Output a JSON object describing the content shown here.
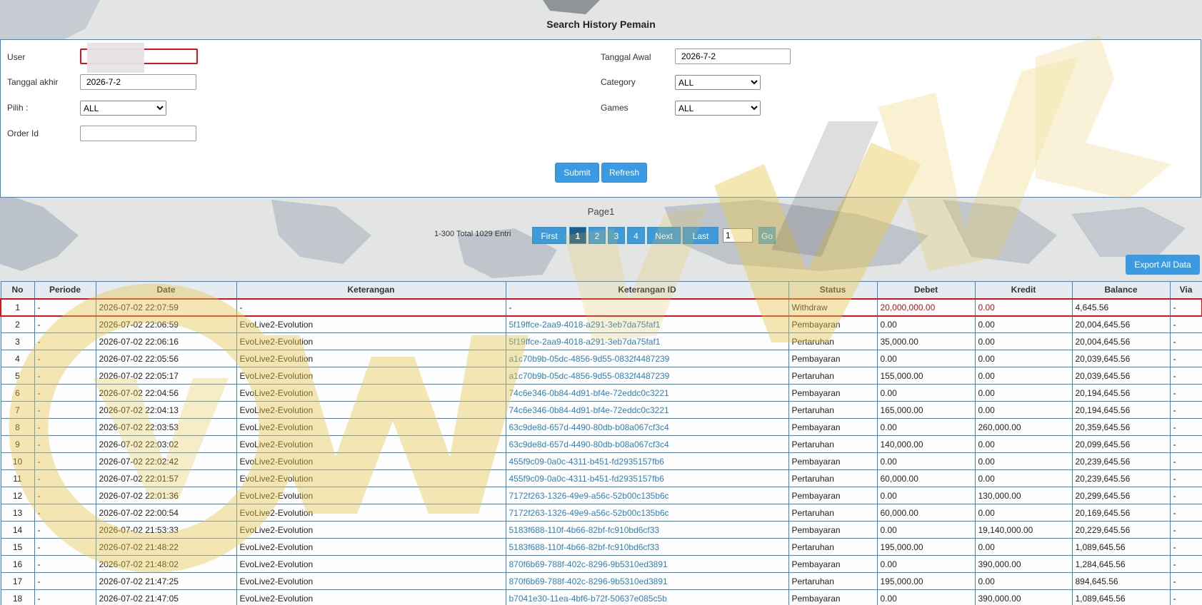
{
  "page_title": "Search History Pemain",
  "form": {
    "user_label": "User",
    "user_value": "",
    "tanggal_akhir_label": "Tanggal akhir",
    "tanggal_akhir_value": "2026-7-2",
    "pilih_label": "Pilih  :",
    "pilih_value": "ALL",
    "order_id_label": "Order Id",
    "order_id_value": "",
    "tanggal_awal_label": "Tanggal Awal",
    "tanggal_awal_value": "2026-7-2",
    "category_label": "Category",
    "category_value": "ALL",
    "games_label": "Games",
    "games_value": "ALL",
    "submit_label": "Submit",
    "refresh_label": "Refresh"
  },
  "pagination": {
    "page_label": "Page1",
    "info": "1-300 Total 1029 Entri",
    "first": "First",
    "pages": [
      "1",
      "2",
      "3",
      "4"
    ],
    "next": "Next",
    "last": "Last",
    "goto_value": "1",
    "go": "Go"
  },
  "export_label": "Export All Data",
  "table": {
    "headers": [
      "No",
      "Periode",
      "Date",
      "Keterangan",
      "Keterangan ID",
      "Status",
      "Debet",
      "Kredit",
      "Balance",
      "Via"
    ],
    "rows": [
      [
        "1",
        "-",
        "2026-07-02 22:07:59",
        "-",
        "-",
        "Withdraw",
        "20,000,000.00",
        "0.00",
        "4,645.56",
        "-"
      ],
      [
        "2",
        "-",
        "2026-07-02 22:06:59",
        "EvoLive2-Evolution",
        "5f19ffce-2aa9-4018-a291-3eb7da75faf1",
        "Pembayaran",
        "0.00",
        "0.00",
        "20,004,645.56",
        "-"
      ],
      [
        "3",
        "-",
        "2026-07-02 22:06:16",
        "EvoLive2-Evolution",
        "5f19ffce-2aa9-4018-a291-3eb7da75faf1",
        "Pertaruhan",
        "35,000.00",
        "0.00",
        "20,004,645.56",
        "-"
      ],
      [
        "4",
        "-",
        "2026-07-02 22:05:56",
        "EvoLive2-Evolution",
        "a1c70b9b-05dc-4856-9d55-0832f4487239",
        "Pembayaran",
        "0.00",
        "0.00",
        "20,039,645.56",
        "-"
      ],
      [
        "5",
        "-",
        "2026-07-02 22:05:17",
        "EvoLive2-Evolution",
        "a1c70b9b-05dc-4856-9d55-0832f4487239",
        "Pertaruhan",
        "155,000.00",
        "0.00",
        "20,039,645.56",
        "-"
      ],
      [
        "6",
        "-",
        "2026-07-02 22:04:56",
        "EvoLive2-Evolution",
        "74c6e346-0b84-4d91-bf4e-72eddc0c3221",
        "Pembayaran",
        "0.00",
        "0.00",
        "20,194,645.56",
        "-"
      ],
      [
        "7",
        "-",
        "2026-07-02 22:04:13",
        "EvoLive2-Evolution",
        "74c6e346-0b84-4d91-bf4e-72eddc0c3221",
        "Pertaruhan",
        "165,000.00",
        "0.00",
        "20,194,645.56",
        "-"
      ],
      [
        "8",
        "-",
        "2026-07-02 22:03:53",
        "EvoLive2-Evolution",
        "63c9de8d-657d-4490-80db-b08a067cf3c4",
        "Pembayaran",
        "0.00",
        "260,000.00",
        "20,359,645.56",
        "-"
      ],
      [
        "9",
        "-",
        "2026-07-02 22:03:02",
        "EvoLive2-Evolution",
        "63c9de8d-657d-4490-80db-b08a067cf3c4",
        "Pertaruhan",
        "140,000.00",
        "0.00",
        "20,099,645.56",
        "-"
      ],
      [
        "10",
        "-",
        "2026-07-02 22:02:42",
        "EvoLive2-Evolution",
        "455f9c09-0a0c-4311-b451-fd2935157fb6",
        "Pembayaran",
        "0.00",
        "0.00",
        "20,239,645.56",
        "-"
      ],
      [
        "11",
        "-",
        "2026-07-02 22:01:57",
        "EvoLive2-Evolution",
        "455f9c09-0a0c-4311-b451-fd2935157fb6",
        "Pertaruhan",
        "60,000.00",
        "0.00",
        "20,239,645.56",
        "-"
      ],
      [
        "12",
        "-",
        "2026-07-02 22:01:36",
        "EvoLive2-Evolution",
        "7172f263-1326-49e9-a56c-52b00c135b6c",
        "Pembayaran",
        "0.00",
        "130,000.00",
        "20,299,645.56",
        "-"
      ],
      [
        "13",
        "-",
        "2026-07-02 22:00:54",
        "EvoLive2-Evolution",
        "7172f263-1326-49e9-a56c-52b00c135b6c",
        "Pertaruhan",
        "60,000.00",
        "0.00",
        "20,169,645.56",
        "-"
      ],
      [
        "14",
        "-",
        "2026-07-02 21:53:33",
        "EvoLive2-Evolution",
        "5183f688-110f-4b66-82bf-fc910bd6cf33",
        "Pembayaran",
        "0.00",
        "19,140,000.00",
        "20,229,645.56",
        "-"
      ],
      [
        "15",
        "-",
        "2026-07-02 21:48:22",
        "EvoLive2-Evolution",
        "5183f688-110f-4b66-82bf-fc910bd6cf33",
        "Pertaruhan",
        "195,000.00",
        "0.00",
        "1,089,645.56",
        "-"
      ],
      [
        "16",
        "-",
        "2026-07-02 21:48:02",
        "EvoLive2-Evolution",
        "870f6b69-788f-402c-8296-9b5310ed3891",
        "Pembayaran",
        "0.00",
        "390,000.00",
        "1,284,645.56",
        "-"
      ],
      [
        "17",
        "-",
        "2026-07-02 21:47:25",
        "EvoLive2-Evolution",
        "870f6b69-788f-402c-8296-9b5310ed3891",
        "Pertaruhan",
        "195,000.00",
        "0.00",
        "894,645.56",
        "-"
      ],
      [
        "18",
        "-",
        "2026-07-02 21:47:05",
        "EvoLive2-Evolution",
        "b7041e30-11ea-4bf6-b72f-50637e085c5b",
        "Pembayaran",
        "0.00",
        "390,000.00",
        "1,089,645.56",
        "-"
      ]
    ]
  },
  "colors": {
    "accent": "#3a9be3",
    "border": "#3a86c7",
    "highlight": "#d3161c",
    "watermark": "#e8c64a"
  }
}
